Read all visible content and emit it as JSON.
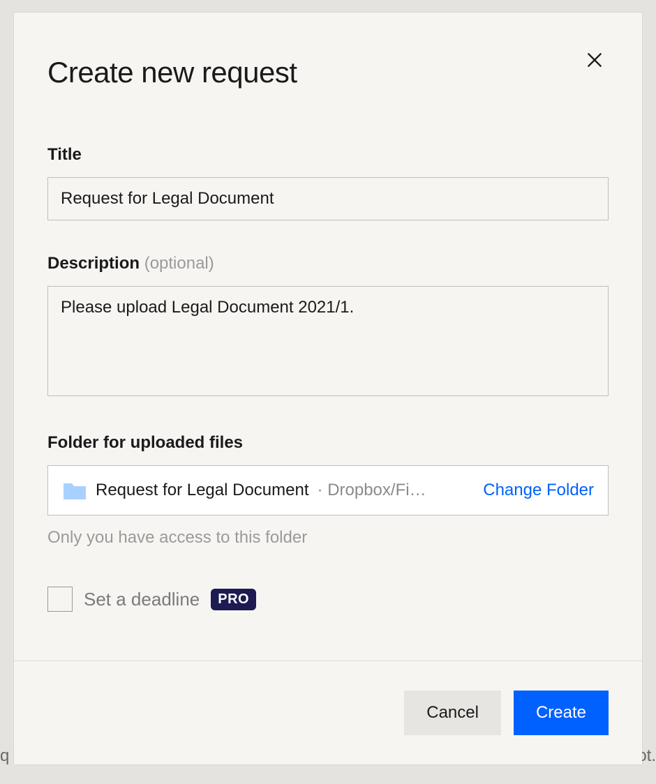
{
  "modal": {
    "title": "Create new request",
    "fields": {
      "title_label": "Title",
      "title_value": "Request for Legal Document",
      "description_label": "Description ",
      "description_optional": "(optional)",
      "description_value": "Please upload Legal Document 2021/1.",
      "folder_label": "Folder for uploaded files",
      "folder_name": "Request for Legal Document",
      "folder_path_separator": " · ",
      "folder_path": "Dropbox/Fi…",
      "change_folder": "Change Folder",
      "folder_note": "Only you have access to this folder",
      "deadline_label": "Set a deadline",
      "pro_badge": "PRO"
    },
    "buttons": {
      "cancel": "Cancel",
      "create": "Create"
    }
  },
  "background": {
    "left_fragment": "q",
    "right_fragment": "ot."
  }
}
